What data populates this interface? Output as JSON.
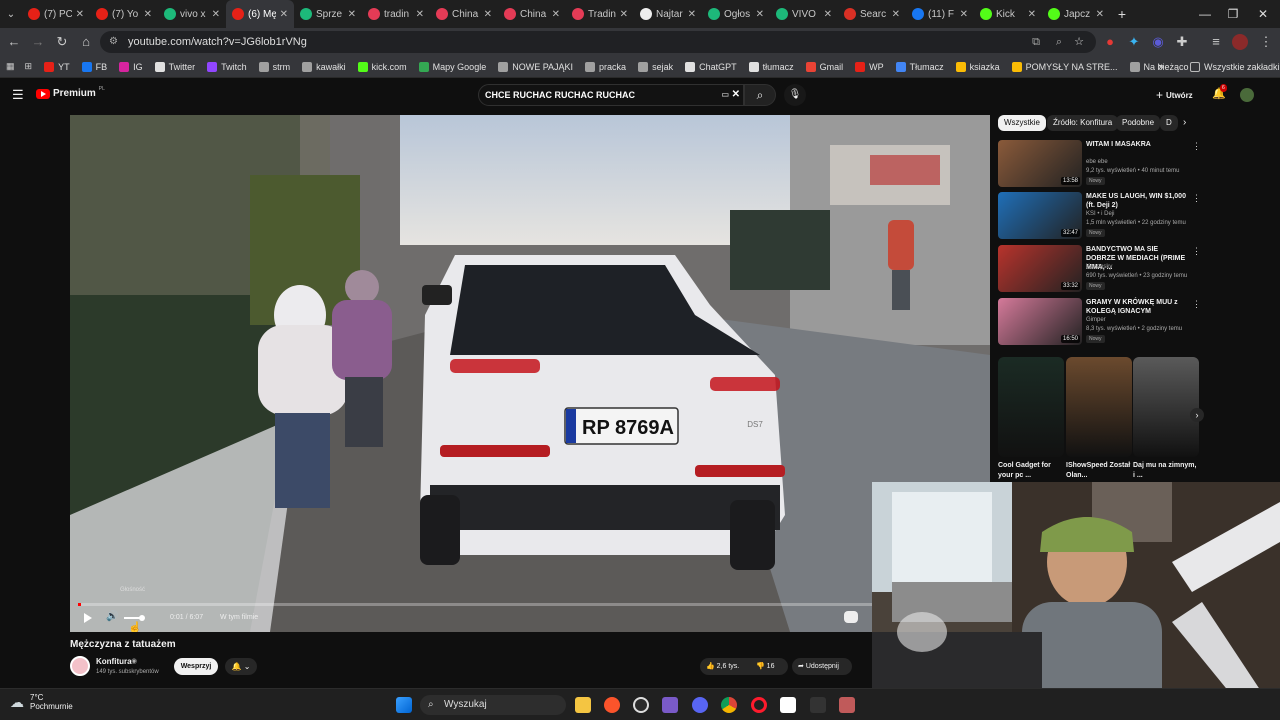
{
  "browser": {
    "tabs": [
      {
        "label": "(7) PC",
        "color": "#e62117"
      },
      {
        "label": "(7) Yo",
        "color": "#e62117"
      },
      {
        "label": "vivo x",
        "color": "#1db97a"
      },
      {
        "label": "(6) Mę",
        "color": "#e62117",
        "active": true
      },
      {
        "label": "Sprze",
        "color": "#1db97a"
      },
      {
        "label": "tradin",
        "color": "#e43b56"
      },
      {
        "label": "China",
        "color": "#e43b56"
      },
      {
        "label": "China",
        "color": "#e43b56"
      },
      {
        "label": "Tradin",
        "color": "#e43b56"
      },
      {
        "label": "Najtar",
        "color": "#eeeeee"
      },
      {
        "label": "Ogłos",
        "color": "#1db97a"
      },
      {
        "label": "VIVO",
        "color": "#1db97a"
      },
      {
        "label": "Searc",
        "color": "#d93025"
      },
      {
        "label": "(11) F",
        "color": "#1877f2"
      },
      {
        "label": "Kick",
        "color": "#53fc18"
      },
      {
        "label": "Japcz",
        "color": "#53fc18"
      }
    ],
    "new_tab": "+",
    "url": "youtube.com/watch?v=JG6lob1rVNg",
    "bookmarks": [
      {
        "label": "YT",
        "color": "#e62117"
      },
      {
        "label": "FB",
        "color": "#1877f2"
      },
      {
        "label": "IG",
        "color": "#d6249f"
      },
      {
        "label": "Twitter",
        "color": "#e0e0e0"
      },
      {
        "label": "Twitch",
        "color": "#9146ff"
      },
      {
        "label": "strm",
        "color": "#a0a0a0"
      },
      {
        "label": "kawałki",
        "color": "#a0a0a0"
      },
      {
        "label": "kick.com",
        "color": "#53fc18"
      },
      {
        "label": "Mapy Google",
        "color": "#34a853"
      },
      {
        "label": "NOWE PAJĄKI",
        "color": "#a0a0a0"
      },
      {
        "label": "pracka",
        "color": "#a0a0a0"
      },
      {
        "label": "sejak",
        "color": "#a0a0a0"
      },
      {
        "label": "ChatGPT",
        "color": "#e0e0e0"
      },
      {
        "label": "tłumacz",
        "color": "#e0e0e0"
      },
      {
        "label": "Gmail",
        "color": "#ea4335"
      },
      {
        "label": "WP",
        "color": "#e62117"
      },
      {
        "label": "Tłumacz",
        "color": "#4285f4"
      },
      {
        "label": "ksiazka",
        "color": "#fbbc05"
      },
      {
        "label": "POMYSŁY NA STRE...",
        "color": "#fbbc05"
      },
      {
        "label": "Na bieżąco",
        "color": "#a0a0a0"
      }
    ],
    "bookmarks_more": "»",
    "all_bookmarks": "Wszystkie zakładki"
  },
  "youtube": {
    "logo": "Premium",
    "logo_region": "PL",
    "search_query": "CHCE RUCHAC RUCHAC RUCHAC",
    "create_label": "Utwórz",
    "notification_count": "6",
    "player": {
      "time": "0:01 / 6:07",
      "chapter": "W tym filmie",
      "volume_tooltip": "Głośność",
      "progress": 0.003,
      "plate": "RP 8769A",
      "car_badge": "DS7"
    },
    "video_title": "Mężczyzna z tatuażem",
    "channel": {
      "name": "Konfitura",
      "subscribers": "149 tys. subskrybentów",
      "support": "Wesprzyj"
    },
    "actions": {
      "likes": "2,6 tys.",
      "dislikes": "16",
      "share": "Udostępnij"
    },
    "chips": [
      "Wszystkie",
      "Źródło: Konfitura",
      "Podobne",
      "D"
    ],
    "recommendations": [
      {
        "title": "WITAM I MASAKRA",
        "channel": "ebe ebe",
        "meta": "9,2 tys. wyświetleń • 40 minut temu",
        "badge": "Nowy",
        "duration": "13:58",
        "color": "#8a5a3a"
      },
      {
        "title": "MAKE US LAUGH, WIN $1,000 (ft. Deji 2)",
        "channel": "KSI • i Deji",
        "meta": "1,5 mln wyświetleń • 22 godziny temu",
        "badge": "Nowy",
        "duration": "32:47",
        "color": "#1f6fb8"
      },
      {
        "title": "BANDYCTWO MA SIE DOBRZE W MEDIACH (PRIME MMA, ...",
        "channel": "Konopsky",
        "meta": "690 tys. wyświetleń • 23 godziny temu",
        "badge": "Nowy",
        "duration": "33:32",
        "color": "#b8332c"
      },
      {
        "title": "GRAMY W KRÓWKĘ MUU z KOLEGĄ IGNACYM",
        "channel": "Gimper",
        "meta": "8,3 tys. wyświetleń • 2 godziny temu",
        "badge": "Nowy",
        "duration": "16:50",
        "color": "#d57a9a"
      }
    ],
    "shorts": [
      {
        "title": "Cool Gadget for your pc ...",
        "color": "#1b2b24"
      },
      {
        "title": "IShowSpeed Został Olan...",
        "color": "#6b4a2e"
      },
      {
        "title": "Daj mu na zimnym, i ...",
        "color": "#5a5a5a"
      }
    ]
  },
  "taskbar": {
    "weather_temp": "7°C",
    "weather_desc": "Pochmurnie",
    "search_placeholder": "Wyszukaj"
  }
}
